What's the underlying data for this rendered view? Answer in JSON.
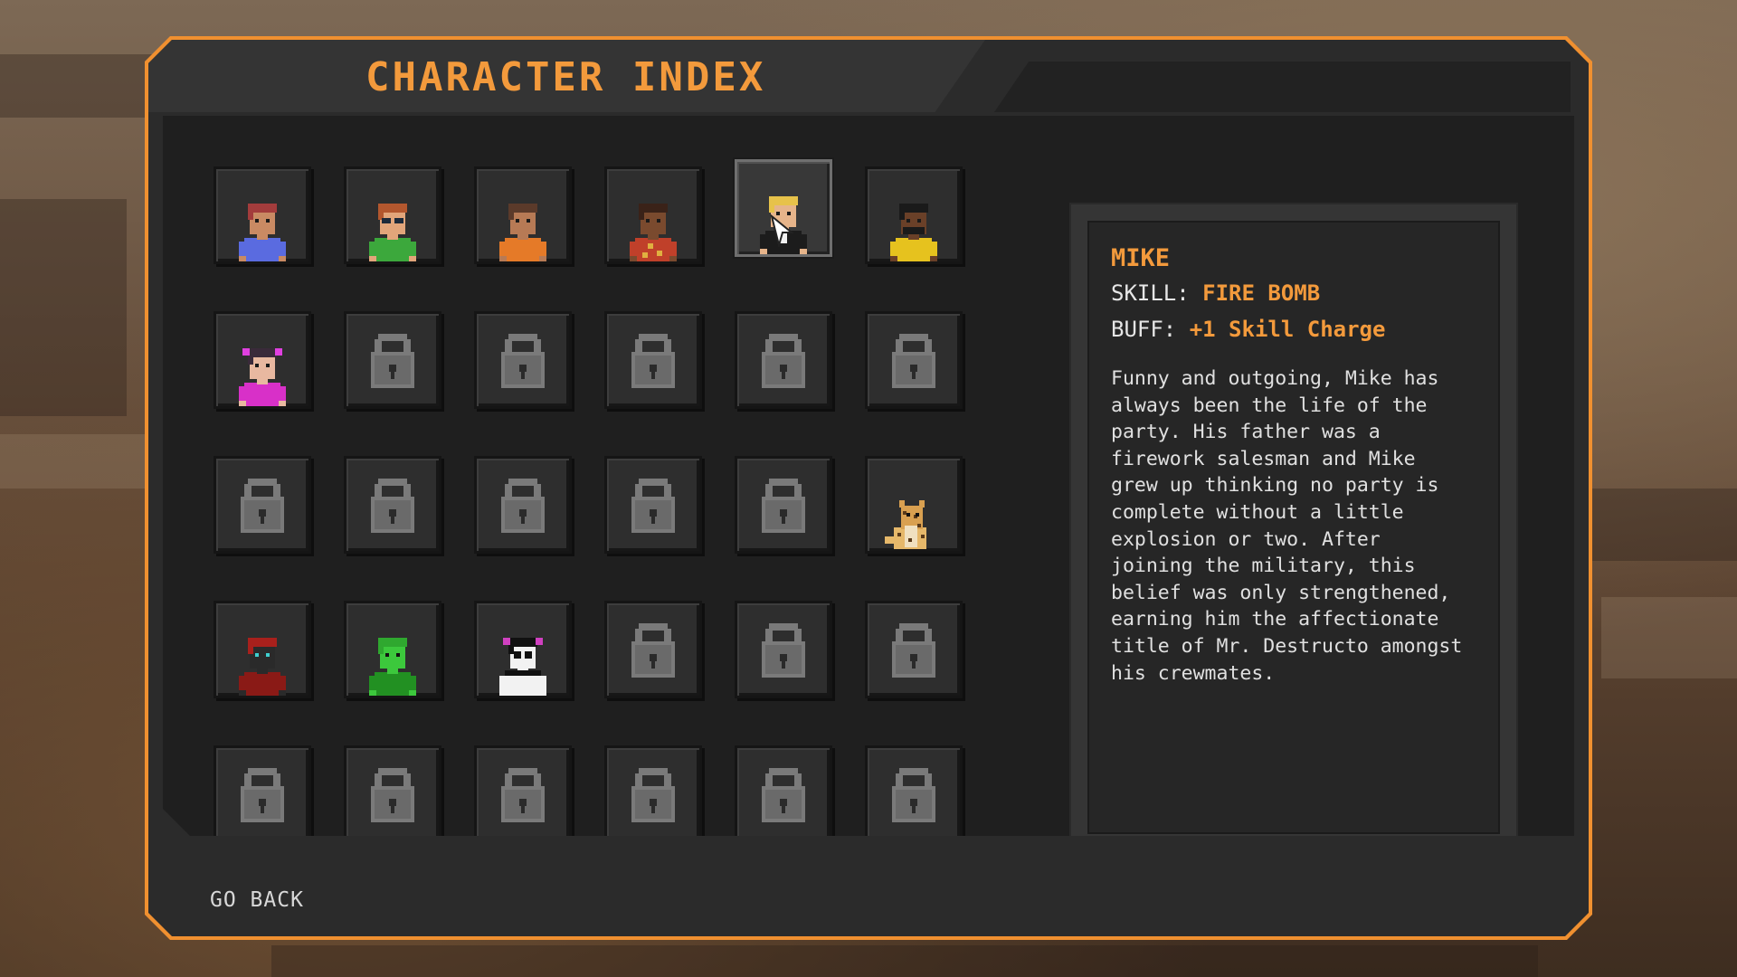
{
  "title": "CHARACTER INDEX",
  "go_back": "GO BACK",
  "selected": {
    "name": "MIKE",
    "skill_label": "SKILL:",
    "skill_value": "FIRE BOMB",
    "buff_label": "BUFF:",
    "buff_value": "+1 Skill Charge",
    "description": "Funny and outgoing, Mike has always been the life of the party. His father was a firework salesman and Mike grew up thinking no party is complete without a little explosion or two. After joining the military, this belief was only strengthened, earning him the affectionate title of Mr. Destructo amongst his crewmates."
  },
  "colors": {
    "accent": "#f39a3c",
    "frame": "#f09030"
  },
  "slots": [
    {
      "state": "unlocked",
      "icon": "red-hair-blue-shirt-character-icon"
    },
    {
      "state": "unlocked",
      "icon": "goggles-green-shirt-character-icon"
    },
    {
      "state": "unlocked",
      "icon": "ponytail-orange-shirt-character-icon"
    },
    {
      "state": "unlocked",
      "icon": "bald-plaid-shirt-character-icon"
    },
    {
      "state": "selected",
      "icon": "mike-blonde-suit-character-icon"
    },
    {
      "state": "unlocked",
      "icon": "beard-yellow-shirt-character-icon"
    },
    {
      "state": "unlocked",
      "icon": "pigtails-pink-shirt-character-icon"
    },
    {
      "state": "locked",
      "icon": "padlock-icon"
    },
    {
      "state": "locked",
      "icon": "padlock-icon"
    },
    {
      "state": "locked",
      "icon": "padlock-icon"
    },
    {
      "state": "locked",
      "icon": "padlock-icon"
    },
    {
      "state": "locked",
      "icon": "padlock-icon"
    },
    {
      "state": "locked",
      "icon": "padlock-icon"
    },
    {
      "state": "locked",
      "icon": "padlock-icon"
    },
    {
      "state": "locked",
      "icon": "padlock-icon"
    },
    {
      "state": "locked",
      "icon": "padlock-icon"
    },
    {
      "state": "locked",
      "icon": "padlock-icon"
    },
    {
      "state": "unlocked",
      "icon": "cheetah-character-icon"
    },
    {
      "state": "unlocked",
      "icon": "red-hood-character-icon"
    },
    {
      "state": "unlocked",
      "icon": "green-frog-character-icon"
    },
    {
      "state": "unlocked",
      "icon": "panda-character-icon"
    },
    {
      "state": "locked",
      "icon": "padlock-icon"
    },
    {
      "state": "locked",
      "icon": "padlock-icon"
    },
    {
      "state": "locked",
      "icon": "padlock-icon"
    },
    {
      "state": "locked",
      "icon": "padlock-icon"
    },
    {
      "state": "locked",
      "icon": "padlock-icon"
    },
    {
      "state": "locked",
      "icon": "padlock-icon"
    },
    {
      "state": "locked",
      "icon": "padlock-icon"
    },
    {
      "state": "locked",
      "icon": "padlock-icon"
    },
    {
      "state": "locked",
      "icon": "padlock-icon"
    }
  ]
}
